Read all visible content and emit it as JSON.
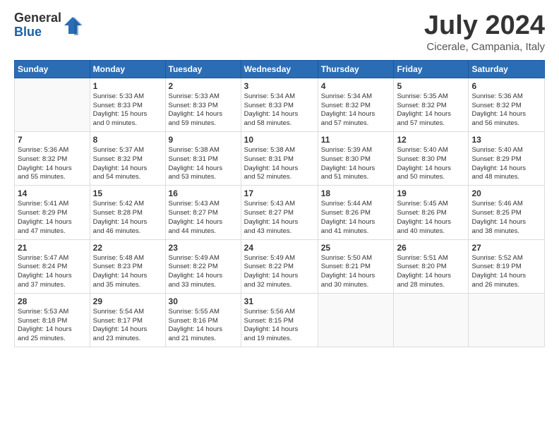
{
  "logo": {
    "general": "General",
    "blue": "Blue"
  },
  "header": {
    "month": "July 2024",
    "location": "Cicerale, Campania, Italy"
  },
  "weekdays": [
    "Sunday",
    "Monday",
    "Tuesday",
    "Wednesday",
    "Thursday",
    "Friday",
    "Saturday"
  ],
  "weeks": [
    [
      {
        "day": "",
        "info": ""
      },
      {
        "day": "1",
        "info": "Sunrise: 5:33 AM\nSunset: 8:33 PM\nDaylight: 15 hours\nand 0 minutes."
      },
      {
        "day": "2",
        "info": "Sunrise: 5:33 AM\nSunset: 8:33 PM\nDaylight: 14 hours\nand 59 minutes."
      },
      {
        "day": "3",
        "info": "Sunrise: 5:34 AM\nSunset: 8:33 PM\nDaylight: 14 hours\nand 58 minutes."
      },
      {
        "day": "4",
        "info": "Sunrise: 5:34 AM\nSunset: 8:32 PM\nDaylight: 14 hours\nand 57 minutes."
      },
      {
        "day": "5",
        "info": "Sunrise: 5:35 AM\nSunset: 8:32 PM\nDaylight: 14 hours\nand 57 minutes."
      },
      {
        "day": "6",
        "info": "Sunrise: 5:36 AM\nSunset: 8:32 PM\nDaylight: 14 hours\nand 56 minutes."
      }
    ],
    [
      {
        "day": "7",
        "info": "Sunrise: 5:36 AM\nSunset: 8:32 PM\nDaylight: 14 hours\nand 55 minutes."
      },
      {
        "day": "8",
        "info": "Sunrise: 5:37 AM\nSunset: 8:32 PM\nDaylight: 14 hours\nand 54 minutes."
      },
      {
        "day": "9",
        "info": "Sunrise: 5:38 AM\nSunset: 8:31 PM\nDaylight: 14 hours\nand 53 minutes."
      },
      {
        "day": "10",
        "info": "Sunrise: 5:38 AM\nSunset: 8:31 PM\nDaylight: 14 hours\nand 52 minutes."
      },
      {
        "day": "11",
        "info": "Sunrise: 5:39 AM\nSunset: 8:30 PM\nDaylight: 14 hours\nand 51 minutes."
      },
      {
        "day": "12",
        "info": "Sunrise: 5:40 AM\nSunset: 8:30 PM\nDaylight: 14 hours\nand 50 minutes."
      },
      {
        "day": "13",
        "info": "Sunrise: 5:40 AM\nSunset: 8:29 PM\nDaylight: 14 hours\nand 48 minutes."
      }
    ],
    [
      {
        "day": "14",
        "info": "Sunrise: 5:41 AM\nSunset: 8:29 PM\nDaylight: 14 hours\nand 47 minutes."
      },
      {
        "day": "15",
        "info": "Sunrise: 5:42 AM\nSunset: 8:28 PM\nDaylight: 14 hours\nand 46 minutes."
      },
      {
        "day": "16",
        "info": "Sunrise: 5:43 AM\nSunset: 8:27 PM\nDaylight: 14 hours\nand 44 minutes."
      },
      {
        "day": "17",
        "info": "Sunrise: 5:43 AM\nSunset: 8:27 PM\nDaylight: 14 hours\nand 43 minutes."
      },
      {
        "day": "18",
        "info": "Sunrise: 5:44 AM\nSunset: 8:26 PM\nDaylight: 14 hours\nand 41 minutes."
      },
      {
        "day": "19",
        "info": "Sunrise: 5:45 AM\nSunset: 8:26 PM\nDaylight: 14 hours\nand 40 minutes."
      },
      {
        "day": "20",
        "info": "Sunrise: 5:46 AM\nSunset: 8:25 PM\nDaylight: 14 hours\nand 38 minutes."
      }
    ],
    [
      {
        "day": "21",
        "info": "Sunrise: 5:47 AM\nSunset: 8:24 PM\nDaylight: 14 hours\nand 37 minutes."
      },
      {
        "day": "22",
        "info": "Sunrise: 5:48 AM\nSunset: 8:23 PM\nDaylight: 14 hours\nand 35 minutes."
      },
      {
        "day": "23",
        "info": "Sunrise: 5:49 AM\nSunset: 8:22 PM\nDaylight: 14 hours\nand 33 minutes."
      },
      {
        "day": "24",
        "info": "Sunrise: 5:49 AM\nSunset: 8:22 PM\nDaylight: 14 hours\nand 32 minutes."
      },
      {
        "day": "25",
        "info": "Sunrise: 5:50 AM\nSunset: 8:21 PM\nDaylight: 14 hours\nand 30 minutes."
      },
      {
        "day": "26",
        "info": "Sunrise: 5:51 AM\nSunset: 8:20 PM\nDaylight: 14 hours\nand 28 minutes."
      },
      {
        "day": "27",
        "info": "Sunrise: 5:52 AM\nSunset: 8:19 PM\nDaylight: 14 hours\nand 26 minutes."
      }
    ],
    [
      {
        "day": "28",
        "info": "Sunrise: 5:53 AM\nSunset: 8:18 PM\nDaylight: 14 hours\nand 25 minutes."
      },
      {
        "day": "29",
        "info": "Sunrise: 5:54 AM\nSunset: 8:17 PM\nDaylight: 14 hours\nand 23 minutes."
      },
      {
        "day": "30",
        "info": "Sunrise: 5:55 AM\nSunset: 8:16 PM\nDaylight: 14 hours\nand 21 minutes."
      },
      {
        "day": "31",
        "info": "Sunrise: 5:56 AM\nSunset: 8:15 PM\nDaylight: 14 hours\nand 19 minutes."
      },
      {
        "day": "",
        "info": ""
      },
      {
        "day": "",
        "info": ""
      },
      {
        "day": "",
        "info": ""
      }
    ]
  ]
}
